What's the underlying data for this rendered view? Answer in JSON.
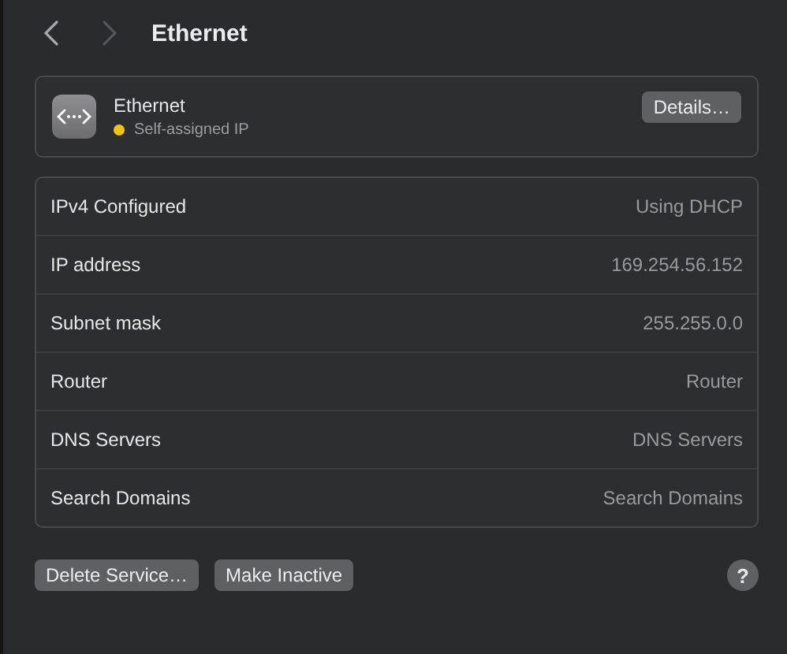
{
  "toolbar": {
    "title": "Ethernet",
    "back": {
      "disabled": false
    },
    "forward": {
      "disabled": true
    }
  },
  "service": {
    "name": "Ethernet",
    "status": {
      "text": "Self-assigned IP",
      "color": "#f5c400"
    },
    "button": "Details…"
  },
  "rows": [
    {
      "label": "IPv4 Configured",
      "value": "Using DHCP"
    },
    {
      "label": "IP address",
      "value": "169.254.56.152"
    },
    {
      "label": "Subnet mask",
      "value": "255.255.0.0"
    },
    {
      "label": "Router",
      "value": "Router"
    },
    {
      "label": "DNS Servers",
      "value": "DNS Servers"
    },
    {
      "label": "Search Domains",
      "value": "Search Domains"
    }
  ],
  "buttons": [
    "Delete Service…",
    "Make Inactive"
  ],
  "help": "?"
}
